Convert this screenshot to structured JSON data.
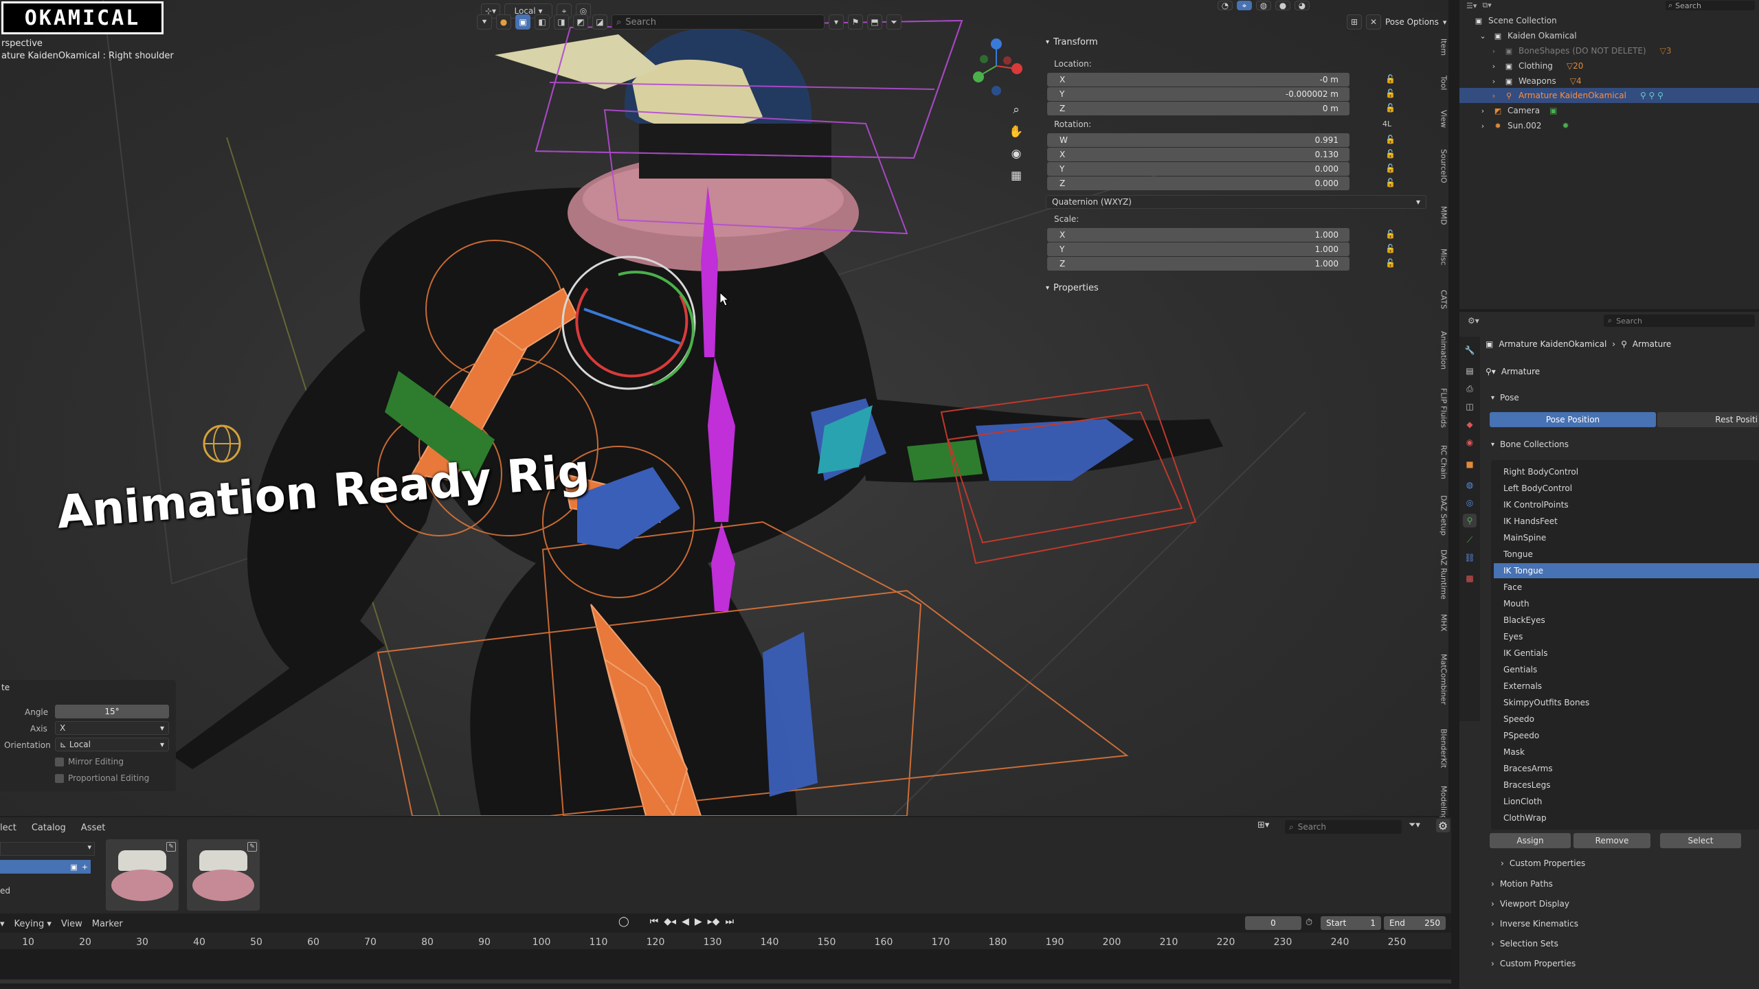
{
  "logo": "OKAMICAL",
  "viewport": {
    "info_line1": "rspective",
    "info_line2": "ature KaidenOkamical : Right shoulder",
    "title_overlay": "Animation Ready Rig",
    "transform_orientation": "Local",
    "search_placeholder": "Search",
    "pose_options": "Pose Options"
  },
  "n_panel": {
    "transform_header": "Transform",
    "location_label": "Location:",
    "location": [
      {
        "axis": "X",
        "value": "-0 m"
      },
      {
        "axis": "Y",
        "value": "-0.000002 m"
      },
      {
        "axis": "Z",
        "value": "0 m"
      }
    ],
    "rotation_label": "Rotation:",
    "rotation_mode_badge": "4L",
    "rotation": [
      {
        "axis": "W",
        "value": "0.991"
      },
      {
        "axis": "X",
        "value": "0.130"
      },
      {
        "axis": "Y",
        "value": "0.000"
      },
      {
        "axis": "Z",
        "value": "0.000"
      }
    ],
    "rotation_mode": "Quaternion (WXYZ)",
    "scale_label": "Scale:",
    "scale": [
      {
        "axis": "X",
        "value": "1.000"
      },
      {
        "axis": "Y",
        "value": "1.000"
      },
      {
        "axis": "Z",
        "value": "1.000"
      }
    ],
    "properties_header": "Properties",
    "tabs": [
      "Item",
      "Tool",
      "View",
      "SourceIO",
      "MMD",
      "Misc",
      "CATS",
      "Animation",
      "FLIP Fluids",
      "RC Chain",
      "DAZ Setup",
      "DAZ Runtime",
      "MHX",
      "MatCombiner",
      "BlenderKit",
      "Modeling"
    ]
  },
  "redo_panel": {
    "title": "te",
    "angle_label": "Angle",
    "angle_value": "15°",
    "axis_label": "Axis",
    "axis_value": "X",
    "orientation_label": "Orientation",
    "orientation_value": "Local",
    "mirror_editing": "Mirror Editing",
    "proportional_editing": "Proportional Editing"
  },
  "outliner": {
    "search_placeholder": "Search",
    "rows": [
      {
        "label": "Scene Collection",
        "indent": 0
      },
      {
        "label": "Kaiden Okamical",
        "indent": 1
      },
      {
        "label": "BoneShapes (DO NOT DELETE)",
        "indent": 2
      },
      {
        "label": "Clothing",
        "indent": 2
      },
      {
        "label": "Weapons",
        "indent": 2
      },
      {
        "label": "Armature KaidenOkamical",
        "indent": 2
      },
      {
        "label": "Camera",
        "indent": 1
      },
      {
        "label": "Sun.002",
        "indent": 1
      }
    ],
    "badges": {
      "boneshapes": "3",
      "clothing": "20",
      "weapons": "4"
    }
  },
  "properties": {
    "search_placeholder": "Search",
    "breadcrumb_object": "Armature KaidenOkamical",
    "breadcrumb_data": "Armature",
    "datablock": "Armature",
    "pose_header": "Pose",
    "pose_position": "Pose Position",
    "rest_position": "Rest Positi",
    "bone_collections_header": "Bone Collections",
    "bone_collections": [
      "Right BodyControl",
      "Left BodyControl",
      "IK ControlPoints",
      "IK HandsFeet",
      "MainSpine",
      "Tongue",
      "IK Tongue",
      "Face",
      "Mouth",
      "BlackEyes",
      "Eyes",
      "IK Gentials",
      "Gentials",
      "Externals",
      "SkimpyOutfits Bones",
      "Speedo",
      "PSpeedo",
      "Mask",
      "BracesArms",
      "BracesLegs",
      "LionCloth",
      "ClothWrap"
    ],
    "selected_collection": "IK Tongue",
    "assign": "Assign",
    "remove": "Remove",
    "select": "Select",
    "custom_properties_inner": "Custom Properties",
    "panels": [
      "Motion Paths",
      "Viewport Display",
      "Inverse Kinematics",
      "Selection Sets",
      "Custom Properties"
    ]
  },
  "asset_browser": {
    "menu": [
      "lect",
      "Catalog",
      "Asset"
    ],
    "search_placeholder": "Search",
    "side_label": "ed"
  },
  "timeline": {
    "menu": [
      "Keying",
      "View",
      "Marker"
    ],
    "current_frame": "0",
    "start_label": "Start",
    "start_value": "1",
    "end_label": "End",
    "end_value": "250",
    "ruler": [
      "10",
      "20",
      "30",
      "40",
      "50",
      "60",
      "70",
      "80",
      "90",
      "100",
      "110",
      "120",
      "130",
      "140",
      "150",
      "160",
      "170",
      "180",
      "190",
      "200",
      "210",
      "220",
      "230",
      "240",
      "250"
    ]
  },
  "colors": {
    "accent": "#4772b3",
    "selected_object": "#ff8e3c",
    "bone_orange": "#e8793a",
    "bone_magenta": "#cc44dd"
  }
}
